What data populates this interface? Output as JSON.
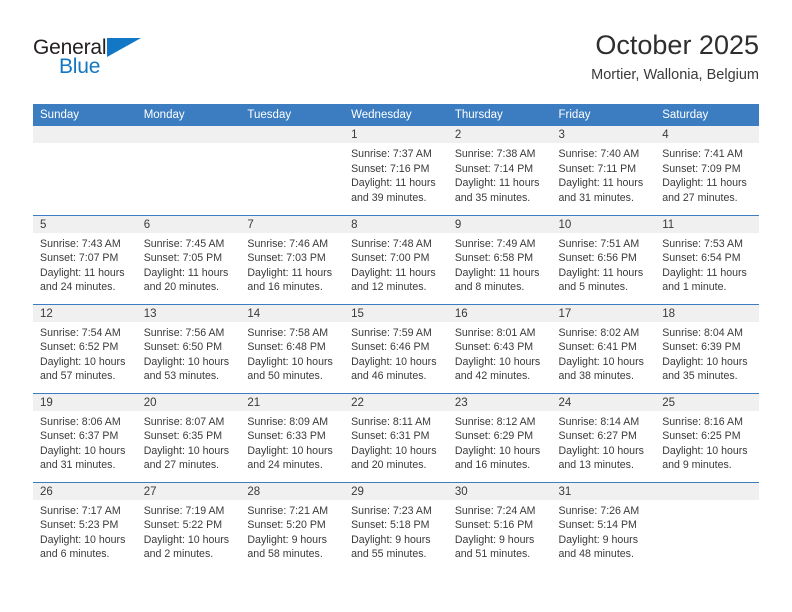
{
  "logo": {
    "part1": "General",
    "part2": "Blue",
    "flag_icon": "triangle-flag-icon",
    "colors": {
      "blue": "#1277c4",
      "dark": "#231f20"
    }
  },
  "header": {
    "title": "October 2025",
    "location": "Mortier, Wallonia, Belgium"
  },
  "theme": {
    "header_bg": "#3b7dc0",
    "daynum_bg": "#f0f0f0",
    "row_divider": "#3b7dc0",
    "text": "#3a3a3a"
  },
  "calendar": {
    "weekday_headers": [
      "Sunday",
      "Monday",
      "Tuesday",
      "Wednesday",
      "Thursday",
      "Friday",
      "Saturday"
    ],
    "weeks": [
      [
        {
          "day": "",
          "empty": true,
          "lines": []
        },
        {
          "day": "",
          "empty": true,
          "lines": []
        },
        {
          "day": "",
          "empty": true,
          "lines": []
        },
        {
          "day": "1",
          "empty": false,
          "lines": [
            "Sunrise: 7:37 AM",
            "Sunset: 7:16 PM",
            "Daylight: 11 hours",
            "and 39 minutes."
          ]
        },
        {
          "day": "2",
          "empty": false,
          "lines": [
            "Sunrise: 7:38 AM",
            "Sunset: 7:14 PM",
            "Daylight: 11 hours",
            "and 35 minutes."
          ]
        },
        {
          "day": "3",
          "empty": false,
          "lines": [
            "Sunrise: 7:40 AM",
            "Sunset: 7:11 PM",
            "Daylight: 11 hours",
            "and 31 minutes."
          ]
        },
        {
          "day": "4",
          "empty": false,
          "lines": [
            "Sunrise: 7:41 AM",
            "Sunset: 7:09 PM",
            "Daylight: 11 hours",
            "and 27 minutes."
          ]
        }
      ],
      [
        {
          "day": "5",
          "empty": false,
          "lines": [
            "Sunrise: 7:43 AM",
            "Sunset: 7:07 PM",
            "Daylight: 11 hours",
            "and 24 minutes."
          ]
        },
        {
          "day": "6",
          "empty": false,
          "lines": [
            "Sunrise: 7:45 AM",
            "Sunset: 7:05 PM",
            "Daylight: 11 hours",
            "and 20 minutes."
          ]
        },
        {
          "day": "7",
          "empty": false,
          "lines": [
            "Sunrise: 7:46 AM",
            "Sunset: 7:03 PM",
            "Daylight: 11 hours",
            "and 16 minutes."
          ]
        },
        {
          "day": "8",
          "empty": false,
          "lines": [
            "Sunrise: 7:48 AM",
            "Sunset: 7:00 PM",
            "Daylight: 11 hours",
            "and 12 minutes."
          ]
        },
        {
          "day": "9",
          "empty": false,
          "lines": [
            "Sunrise: 7:49 AM",
            "Sunset: 6:58 PM",
            "Daylight: 11 hours",
            "and 8 minutes."
          ]
        },
        {
          "day": "10",
          "empty": false,
          "lines": [
            "Sunrise: 7:51 AM",
            "Sunset: 6:56 PM",
            "Daylight: 11 hours",
            "and 5 minutes."
          ]
        },
        {
          "day": "11",
          "empty": false,
          "lines": [
            "Sunrise: 7:53 AM",
            "Sunset: 6:54 PM",
            "Daylight: 11 hours",
            "and 1 minute."
          ]
        }
      ],
      [
        {
          "day": "12",
          "empty": false,
          "lines": [
            "Sunrise: 7:54 AM",
            "Sunset: 6:52 PM",
            "Daylight: 10 hours",
            "and 57 minutes."
          ]
        },
        {
          "day": "13",
          "empty": false,
          "lines": [
            "Sunrise: 7:56 AM",
            "Sunset: 6:50 PM",
            "Daylight: 10 hours",
            "and 53 minutes."
          ]
        },
        {
          "day": "14",
          "empty": false,
          "lines": [
            "Sunrise: 7:58 AM",
            "Sunset: 6:48 PM",
            "Daylight: 10 hours",
            "and 50 minutes."
          ]
        },
        {
          "day": "15",
          "empty": false,
          "lines": [
            "Sunrise: 7:59 AM",
            "Sunset: 6:46 PM",
            "Daylight: 10 hours",
            "and 46 minutes."
          ]
        },
        {
          "day": "16",
          "empty": false,
          "lines": [
            "Sunrise: 8:01 AM",
            "Sunset: 6:43 PM",
            "Daylight: 10 hours",
            "and 42 minutes."
          ]
        },
        {
          "day": "17",
          "empty": false,
          "lines": [
            "Sunrise: 8:02 AM",
            "Sunset: 6:41 PM",
            "Daylight: 10 hours",
            "and 38 minutes."
          ]
        },
        {
          "day": "18",
          "empty": false,
          "lines": [
            "Sunrise: 8:04 AM",
            "Sunset: 6:39 PM",
            "Daylight: 10 hours",
            "and 35 minutes."
          ]
        }
      ],
      [
        {
          "day": "19",
          "empty": false,
          "lines": [
            "Sunrise: 8:06 AM",
            "Sunset: 6:37 PM",
            "Daylight: 10 hours",
            "and 31 minutes."
          ]
        },
        {
          "day": "20",
          "empty": false,
          "lines": [
            "Sunrise: 8:07 AM",
            "Sunset: 6:35 PM",
            "Daylight: 10 hours",
            "and 27 minutes."
          ]
        },
        {
          "day": "21",
          "empty": false,
          "lines": [
            "Sunrise: 8:09 AM",
            "Sunset: 6:33 PM",
            "Daylight: 10 hours",
            "and 24 minutes."
          ]
        },
        {
          "day": "22",
          "empty": false,
          "lines": [
            "Sunrise: 8:11 AM",
            "Sunset: 6:31 PM",
            "Daylight: 10 hours",
            "and 20 minutes."
          ]
        },
        {
          "day": "23",
          "empty": false,
          "lines": [
            "Sunrise: 8:12 AM",
            "Sunset: 6:29 PM",
            "Daylight: 10 hours",
            "and 16 minutes."
          ]
        },
        {
          "day": "24",
          "empty": false,
          "lines": [
            "Sunrise: 8:14 AM",
            "Sunset: 6:27 PM",
            "Daylight: 10 hours",
            "and 13 minutes."
          ]
        },
        {
          "day": "25",
          "empty": false,
          "lines": [
            "Sunrise: 8:16 AM",
            "Sunset: 6:25 PM",
            "Daylight: 10 hours",
            "and 9 minutes."
          ]
        }
      ],
      [
        {
          "day": "26",
          "empty": false,
          "lines": [
            "Sunrise: 7:17 AM",
            "Sunset: 5:23 PM",
            "Daylight: 10 hours",
            "and 6 minutes."
          ]
        },
        {
          "day": "27",
          "empty": false,
          "lines": [
            "Sunrise: 7:19 AM",
            "Sunset: 5:22 PM",
            "Daylight: 10 hours",
            "and 2 minutes."
          ]
        },
        {
          "day": "28",
          "empty": false,
          "lines": [
            "Sunrise: 7:21 AM",
            "Sunset: 5:20 PM",
            "Daylight: 9 hours",
            "and 58 minutes."
          ]
        },
        {
          "day": "29",
          "empty": false,
          "lines": [
            "Sunrise: 7:23 AM",
            "Sunset: 5:18 PM",
            "Daylight: 9 hours",
            "and 55 minutes."
          ]
        },
        {
          "day": "30",
          "empty": false,
          "lines": [
            "Sunrise: 7:24 AM",
            "Sunset: 5:16 PM",
            "Daylight: 9 hours",
            "and 51 minutes."
          ]
        },
        {
          "day": "31",
          "empty": false,
          "lines": [
            "Sunrise: 7:26 AM",
            "Sunset: 5:14 PM",
            "Daylight: 9 hours",
            "and 48 minutes."
          ]
        },
        {
          "day": "",
          "empty": true,
          "lines": []
        }
      ]
    ]
  }
}
